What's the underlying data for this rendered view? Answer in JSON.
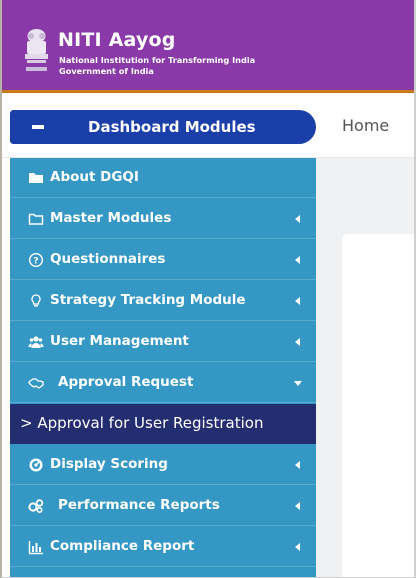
{
  "header": {
    "title": "NITI Aayog",
    "subtitle_line1": "National Institution for Transforming India",
    "subtitle_line2": "Government of India"
  },
  "nav": {
    "dashboard_label": "Dashboard Modules",
    "breadcrumb_home": "Home"
  },
  "sidebar": {
    "items": [
      {
        "label": "About DGQI",
        "icon": "folder-icon"
      },
      {
        "label": "Master Modules",
        "icon": "folder-outline-icon"
      },
      {
        "label": "Questionnaires",
        "icon": "question-circle-icon"
      },
      {
        "label": "Strategy Tracking Module",
        "icon": "lightbulb-icon"
      },
      {
        "label": "User Management",
        "icon": "users-icon"
      },
      {
        "label": "Approval Request",
        "icon": "handshake-icon"
      },
      {
        "label": "> Approval for User Registration",
        "icon": ""
      },
      {
        "label": "Display Scoring",
        "icon": "gauge-icon"
      },
      {
        "label": "Performance Reports",
        "icon": "gears-icon"
      },
      {
        "label": "Compliance Report",
        "icon": "bar-chart-icon"
      }
    ]
  },
  "colors": {
    "header_bg": "#8a3aa8",
    "sidebar_bg": "#3597c4",
    "dashboard_pill": "#1b3fa8",
    "active_sub_bg": "#232d6f"
  }
}
